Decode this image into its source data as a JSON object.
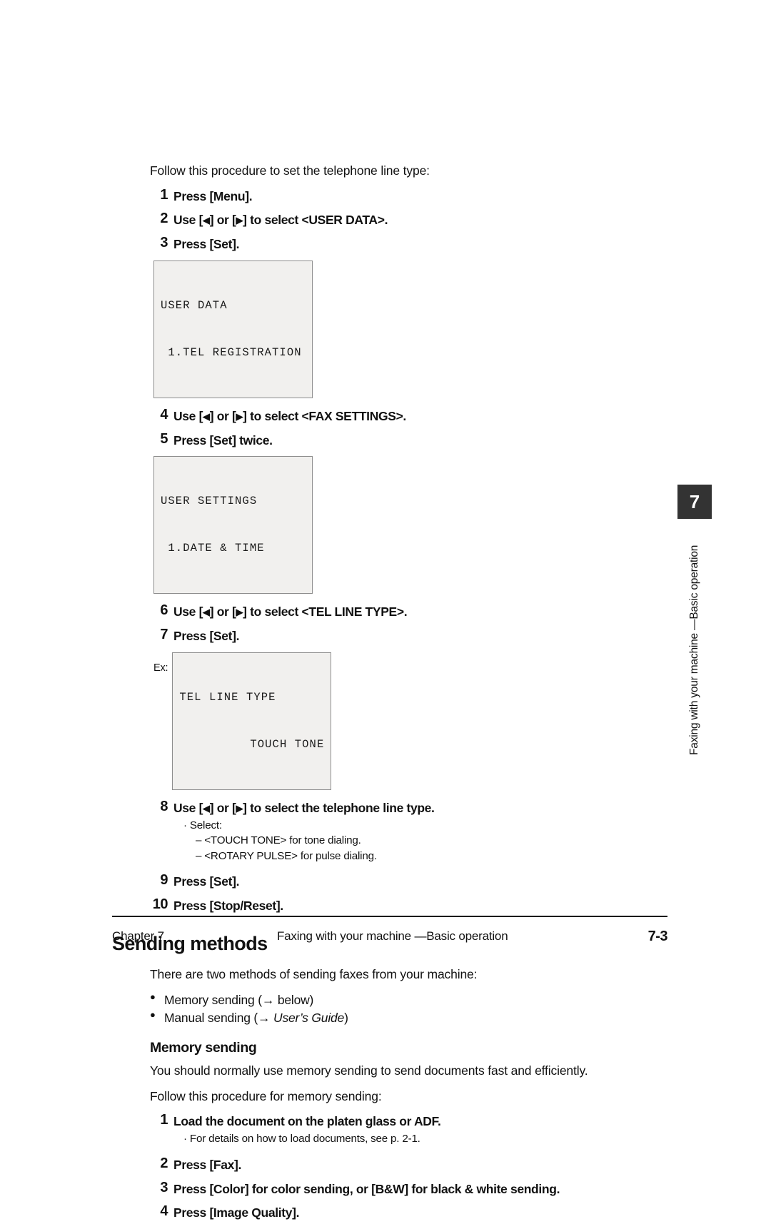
{
  "procedure_intro": "Follow this procedure to set the telephone line type:",
  "tel_line_steps": [
    {
      "num": "1",
      "text": "Press [Menu]."
    },
    {
      "num": "2",
      "pre": "Use [",
      "tri_left": "◀",
      "mid": "] or [",
      "tri_right": "▶",
      "post": "] to select <USER DATA>."
    },
    {
      "num": "3",
      "text": "Press [Set]."
    },
    {
      "num": "4",
      "pre": "Use [",
      "tri_left": "◀",
      "mid": "] or [",
      "tri_right": "▶",
      "post": "] to select <FAX SETTINGS>."
    },
    {
      "num": "5",
      "text": "Press [Set] twice."
    },
    {
      "num": "6",
      "pre": "Use [",
      "tri_left": "◀",
      "mid": "] or [",
      "tri_right": "▶",
      "post": "] to select <TEL LINE TYPE>."
    },
    {
      "num": "7",
      "text": "Press [Set]."
    },
    {
      "num": "8",
      "pre": "Use [",
      "tri_left": "◀",
      "mid": "] or [",
      "tri_right": "▶",
      "post": "] to select the telephone line type."
    },
    {
      "num": "9",
      "text": "Press [Set]."
    },
    {
      "num": "10",
      "text": "Press [Stop/Reset]."
    }
  ],
  "lcd_displays": {
    "user_data": {
      "line1": "USER DATA",
      "line2": " 1.TEL REGISTRATION"
    },
    "user_settings": {
      "line1": "USER SETTINGS",
      "line2": " 1.DATE & TIME"
    },
    "tel_line_type": {
      "ex_label": "Ex:",
      "line1": "TEL LINE TYPE",
      "line2": "TOUCH TONE"
    }
  },
  "step8_notes": {
    "select_label": "· Select:",
    "option1": "– <TOUCH TONE> for tone dialing.",
    "option2": "– <ROTARY PULSE> for pulse dialing."
  },
  "sending_methods": {
    "heading": "Sending methods",
    "intro": "There are two methods of sending faxes from your machine:",
    "bullets": [
      {
        "glyph": "●",
        "text": "Memory sending (→ below)"
      },
      {
        "glyph": "●",
        "pre": "Manual sending (→ ",
        "italic": "User’s Guide",
        "post": ")"
      }
    ]
  },
  "memory_sending": {
    "heading": "Memory sending",
    "intro": "You should normally use memory sending to send documents fast and efficiently.",
    "procedure_intro": "Follow this procedure for memory sending:",
    "steps": [
      {
        "num": "1",
        "text": "Load the document on the platen glass or ADF.",
        "note": "· For details on how to load documents, see p. 2-1."
      },
      {
        "num": "2",
        "text": "Press [Fax]."
      },
      {
        "num": "3",
        "text": "Press [Color] for color sending, or [B&W] for black & white sending."
      },
      {
        "num": "4",
        "text": "Press [Image Quality]."
      }
    ]
  },
  "chapter_tab": {
    "number": "7",
    "vertical_label": "Faxing with your machine —Basic operation"
  },
  "footer": {
    "chapter": "Chapter 7",
    "center": "Faxing with your machine —Basic operation",
    "page": "7-3"
  },
  "colors": {
    "tab_background": "#333333",
    "lcd_background": "#f1f0ee",
    "lcd_border": "#8d8d8d",
    "text": "#111111"
  }
}
